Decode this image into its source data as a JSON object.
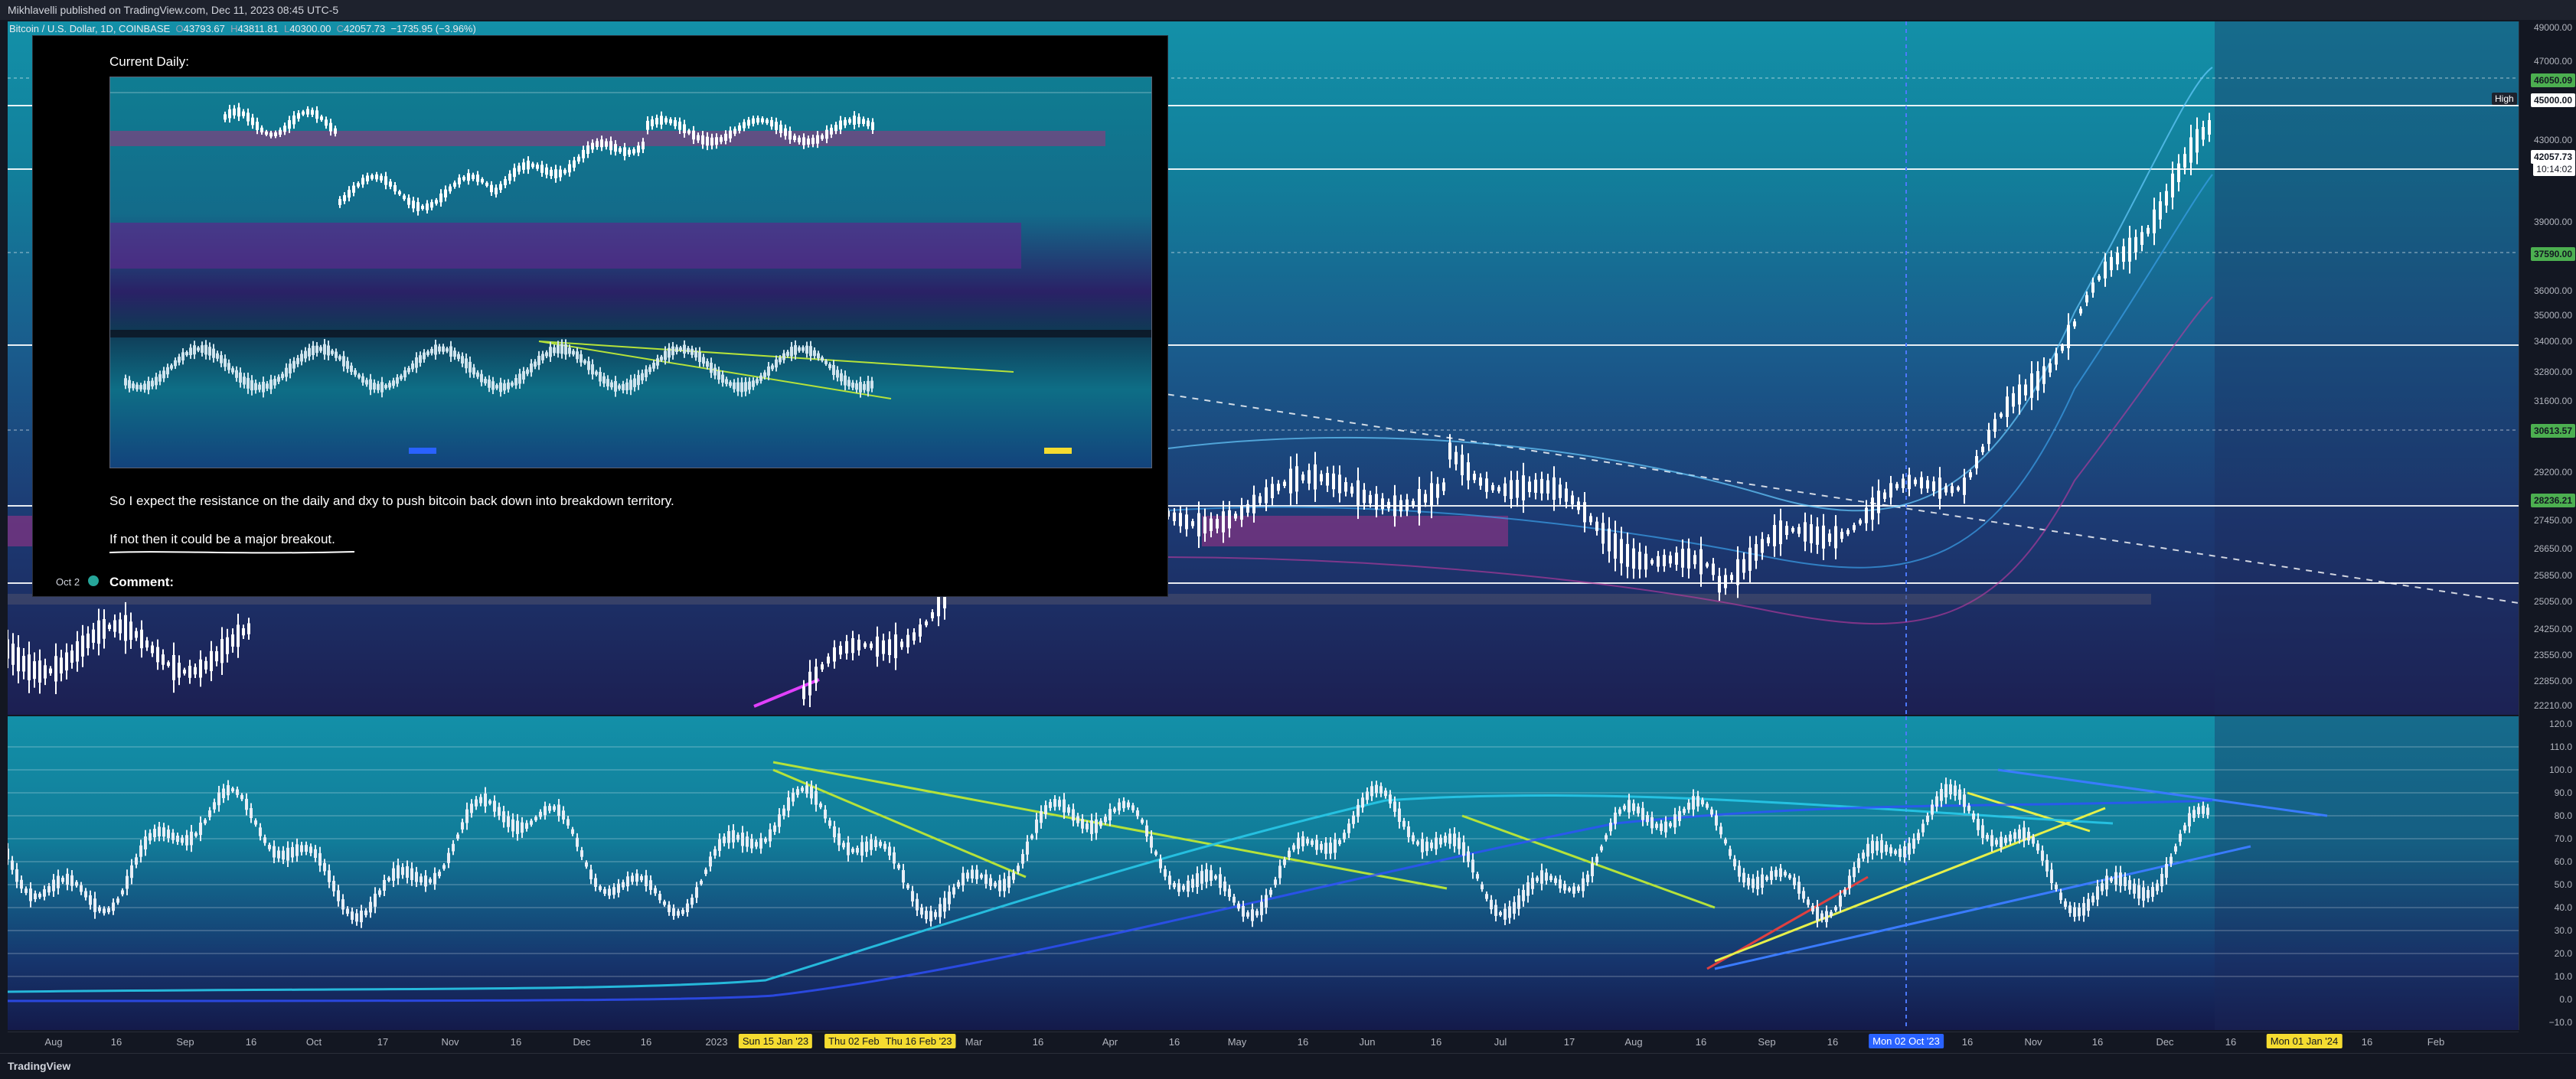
{
  "header": {
    "published": "Mikhlavelli published on TradingView.com, Dec 11, 2023 08:45 UTC-5"
  },
  "symbol": {
    "name": "Bitcoin / U.S. Dollar, 1D, COINBASE",
    "o_label": "O",
    "o": "43793.67",
    "h_label": "H",
    "h": "43811.81",
    "l_label": "L",
    "l": "40300.00",
    "c_label": "C",
    "c": "42057.73",
    "change": "−1735.95 (−3.96%)"
  },
  "idea_card": {
    "title": "Current Daily:",
    "text_1": "So I expect the resistance on the daily and dxy to push bitcoin back down into breakdown territory.",
    "text_2": "If not then it could be a major breakout.",
    "date": "Oct 2",
    "comment_label": "Comment:"
  },
  "price_axis": {
    "ticks": [
      "49000.00",
      "47000.00",
      "43000.00",
      "39000.00",
      "36000.00",
      "35000.00",
      "34000.00",
      "32800.00",
      "31600.00",
      "29200.00",
      "27450.00",
      "26650.00",
      "25850.00",
      "25050.00",
      "24250.00",
      "23550.00",
      "22850.00",
      "22210.00"
    ],
    "badges": {
      "level_1": "46050.09",
      "high_label": "High",
      "high": "45000.00",
      "current": "42057.73",
      "countdown": "10:14:02",
      "level_2": "37590.00",
      "level_3": "30613.57",
      "level_4": "28236.21"
    }
  },
  "osc_axis": {
    "ticks": [
      "120.0",
      "110.0",
      "100.0",
      "90.0",
      "80.0",
      "70.0",
      "60.0",
      "50.0",
      "40.0",
      "30.0",
      "20.0",
      "10.0",
      "0.0",
      "−10.0"
    ]
  },
  "time_axis": {
    "ticks": [
      "Aug",
      "16",
      "Sep",
      "16",
      "Oct",
      "17",
      "Nov",
      "16",
      "Dec",
      "16",
      "2023",
      "Mar",
      "16",
      "Apr",
      "16",
      "May",
      "16",
      "Jun",
      "16",
      "Jul",
      "17",
      "Aug",
      "16",
      "Sep",
      "16",
      "16",
      "Nov",
      "16",
      "Dec",
      "16",
      "16",
      "Feb"
    ],
    "badge_1": "Sun 15 Jan '23",
    "badge_2": "Thu 02 Feb '2",
    "badge_3": "Thu 16 Feb '23",
    "badge_4": "Mon 02 Oct '23",
    "badge_5": "Mon 01 Jan '24"
  },
  "footer": {
    "logo": "TradingView"
  },
  "colors": {
    "accent_up": "#ffffff",
    "level_badge": "#4caf50",
    "highlight": "#f5dc30",
    "crosshair": "#2962ff"
  }
}
